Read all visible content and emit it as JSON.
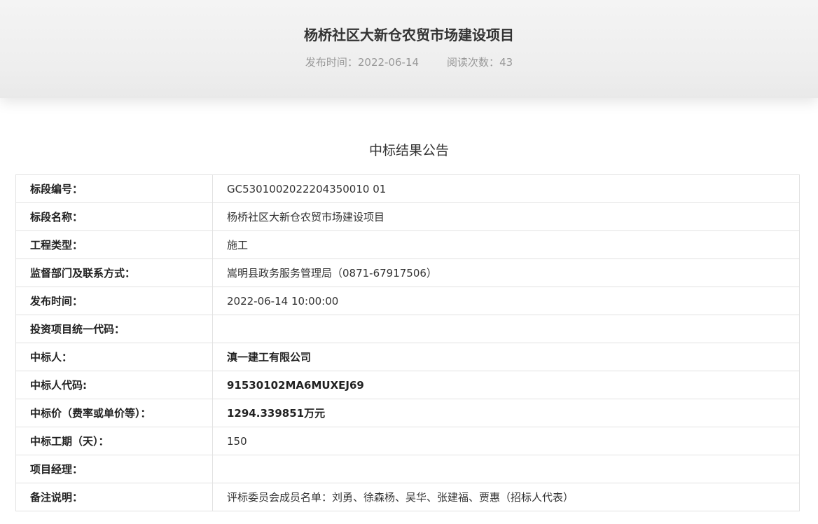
{
  "header": {
    "title": "杨桥社区大新仓农贸市场建设项目",
    "publish_label": "发布时间：",
    "publish_date": "2022-06-14",
    "views_label": "阅读次数：",
    "views_count": "43"
  },
  "notice": {
    "title": "中标结果公告"
  },
  "rows": [
    {
      "label": "标段编号：",
      "value": "GC5301002022204350010 01"
    },
    {
      "label": "标段名称：",
      "value": "杨桥社区大新仓农贸市场建设项目"
    },
    {
      "label": "工程类型：",
      "value": "施工"
    },
    {
      "label": "监督部门及联系方式：",
      "value": "嵩明县政务服务管理局（0871-67917506）"
    },
    {
      "label": "发布时间：",
      "value": "2022-06-14 10:00:00"
    },
    {
      "label": "投资项目统一代码：",
      "value": ""
    },
    {
      "label": "中标人：",
      "value": "滇一建工有限公司"
    },
    {
      "label": "中标人代码:",
      "value": "91530102MA6MUXEJ69"
    },
    {
      "label": "中标价（费率或单价等）：",
      "value": "1294.339851万元"
    },
    {
      "label": "中标工期（天）：",
      "value": "150"
    },
    {
      "label": "项目经理：",
      "value": ""
    },
    {
      "label": "备注说明：",
      "value": "评标委员会成员名单：刘勇、徐森杨、吴华、张建福、贾惠（招标人代表）"
    }
  ]
}
